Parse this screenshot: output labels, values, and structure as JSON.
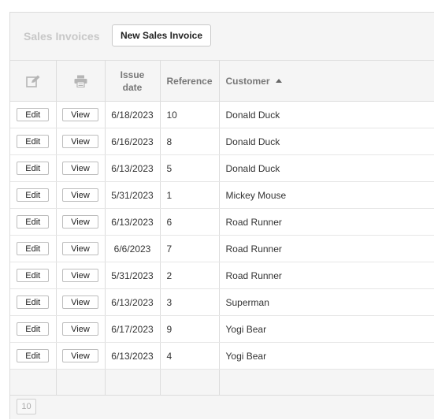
{
  "toolbar": {
    "title": "Sales Invoices",
    "new_button_label": "New Sales Invoice"
  },
  "grid": {
    "headers": {
      "edit_icon": "edit-icon",
      "view_icon": "printer-icon",
      "issue_date": "Issue date",
      "reference": "Reference",
      "customer": "Customer"
    },
    "sort": {
      "column": "Customer",
      "direction": "ascending"
    },
    "edit_label": "Edit",
    "view_label": "View",
    "rows": [
      {
        "issue_date": "6/18/2023",
        "reference": "10",
        "customer": "Donald Duck"
      },
      {
        "issue_date": "6/16/2023",
        "reference": "8",
        "customer": "Donald Duck"
      },
      {
        "issue_date": "6/13/2023",
        "reference": "5",
        "customer": "Donald Duck"
      },
      {
        "issue_date": "5/31/2023",
        "reference": "1",
        "customer": "Mickey Mouse"
      },
      {
        "issue_date": "6/13/2023",
        "reference": "6",
        "customer": "Road Runner"
      },
      {
        "issue_date": "6/6/2023",
        "reference": "7",
        "customer": "Road Runner"
      },
      {
        "issue_date": "5/31/2023",
        "reference": "2",
        "customer": "Road Runner"
      },
      {
        "issue_date": "6/13/2023",
        "reference": "3",
        "customer": "Superman"
      },
      {
        "issue_date": "6/17/2023",
        "reference": "9",
        "customer": "Yogi Bear"
      },
      {
        "issue_date": "6/13/2023",
        "reference": "4",
        "customer": "Yogi Bear"
      }
    ]
  },
  "footer": {
    "page_size": "10"
  }
}
